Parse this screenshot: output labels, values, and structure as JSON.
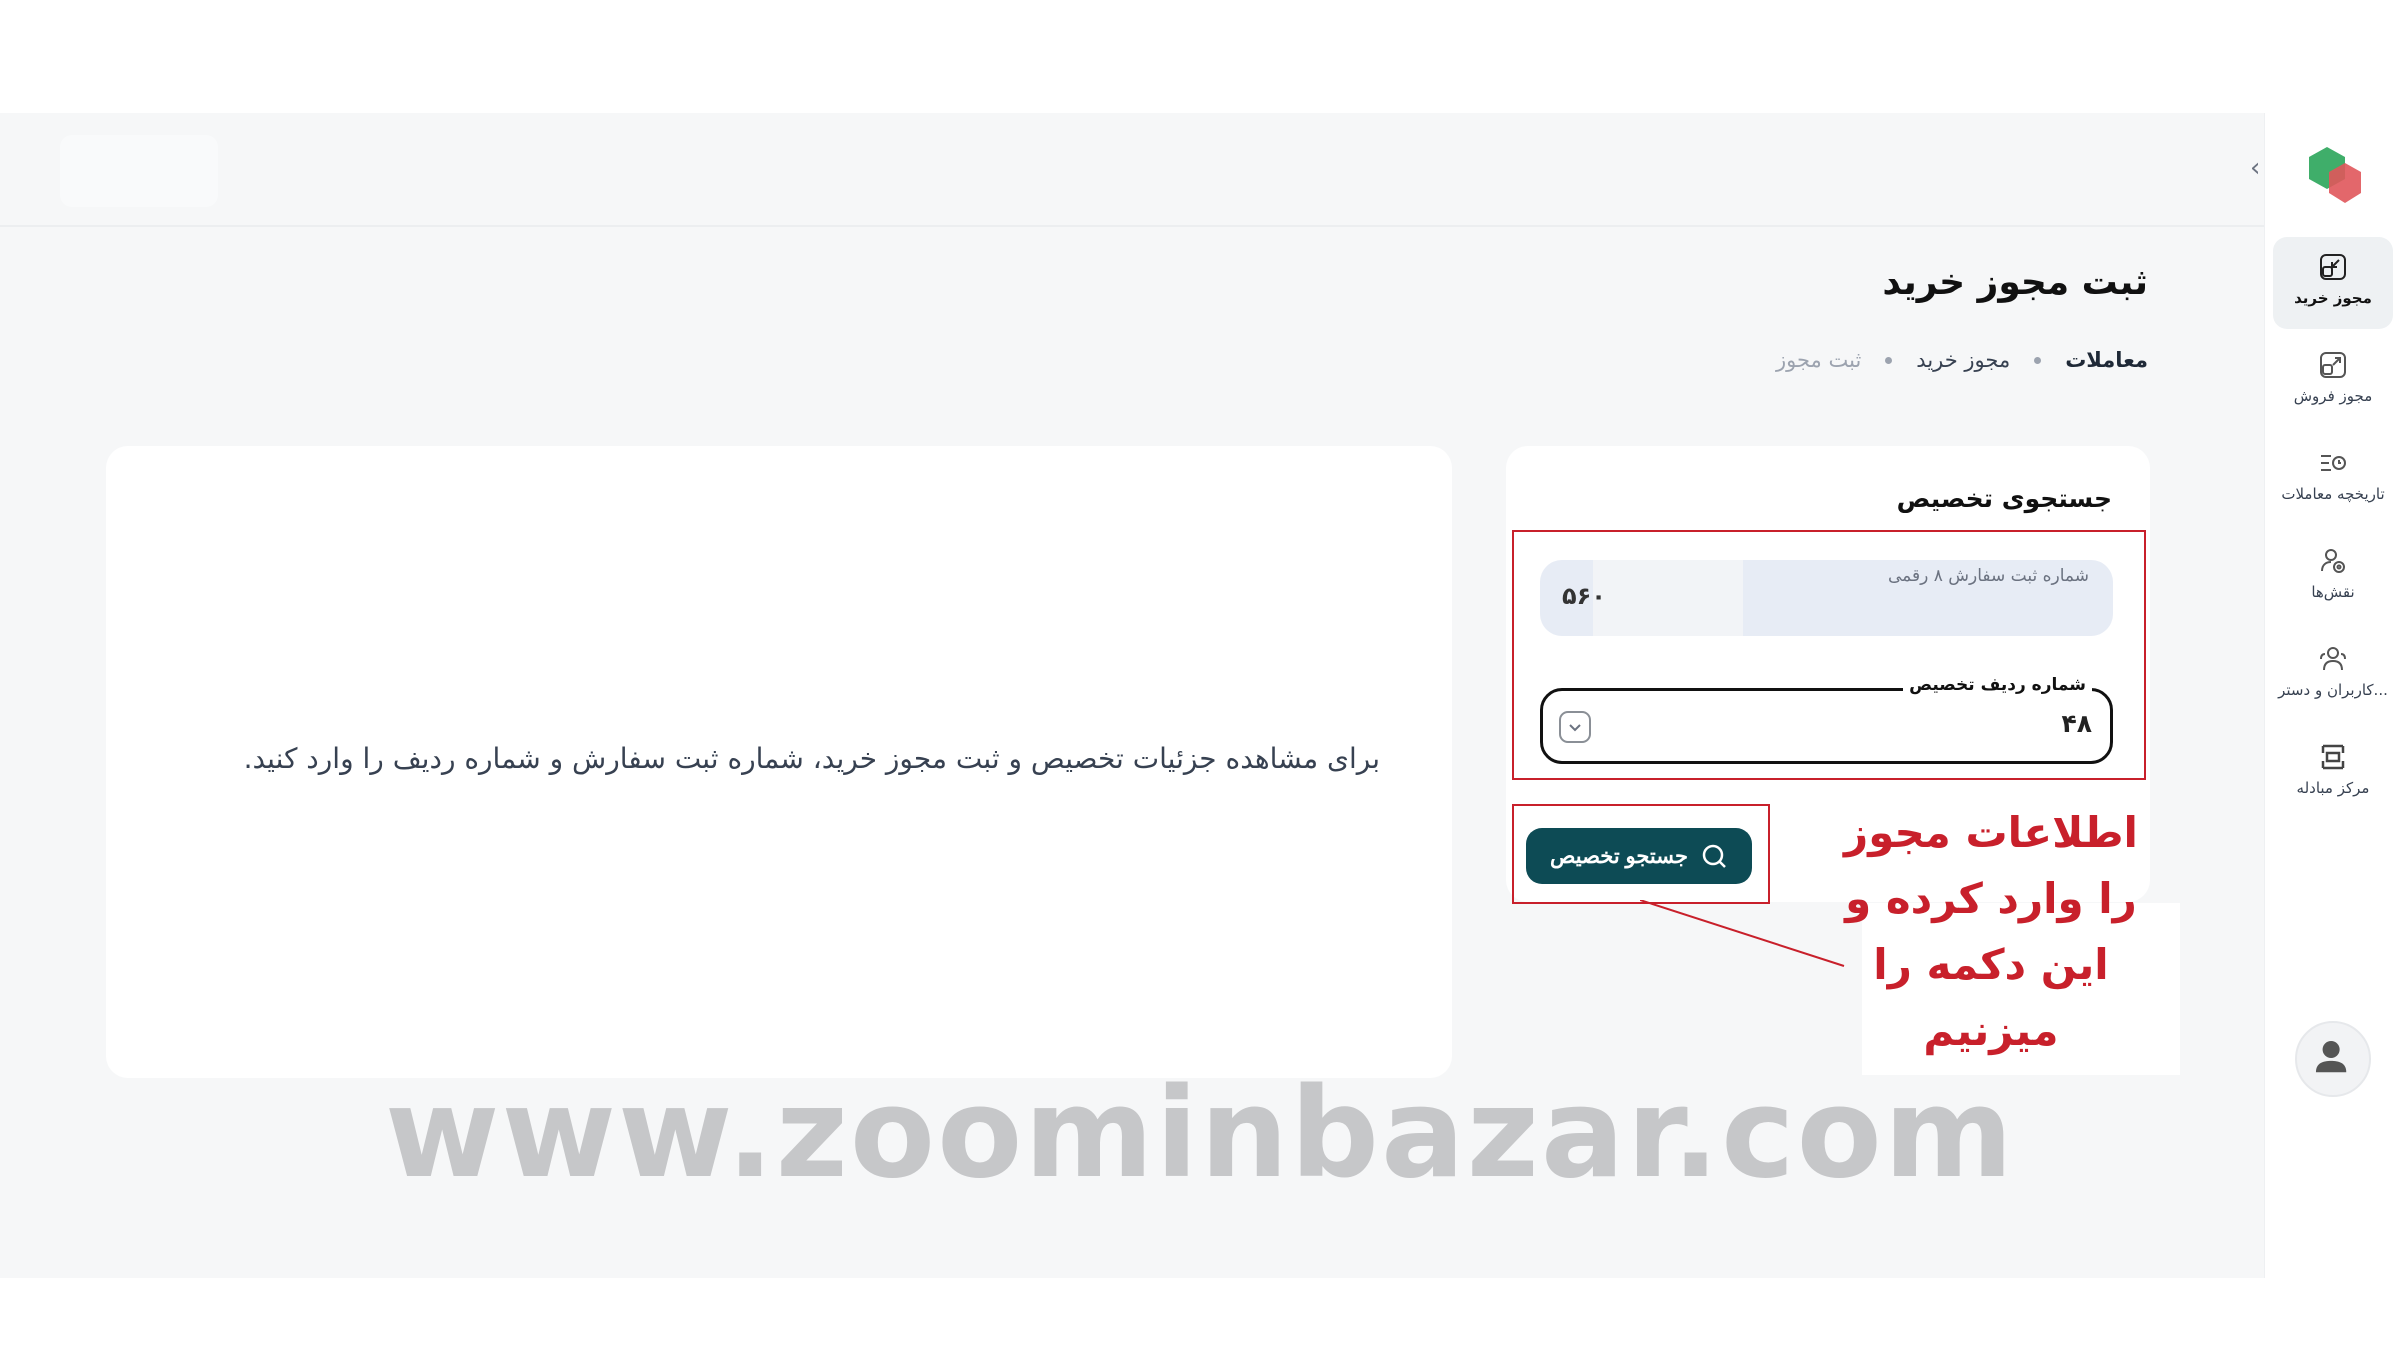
{
  "header": {
    "page_title": "ثبت مجوز خرید",
    "breadcrumb": [
      "معاملات",
      "مجوز خرید",
      "ثبت مجوز"
    ]
  },
  "sidebar": {
    "items": [
      {
        "label": "مجوز خرید",
        "icon": "purchase-permit-icon",
        "active": true
      },
      {
        "label": "مجوز فروش",
        "icon": "sale-permit-icon",
        "active": false
      },
      {
        "label": "تاریخچه معاملات",
        "icon": "history-icon",
        "active": false
      },
      {
        "label": "نقش‌ها",
        "icon": "roles-icon",
        "active": false
      },
      {
        "label": "کاربران و دستر...",
        "icon": "users-icon",
        "active": false
      },
      {
        "label": "مرکز مبادله",
        "icon": "exchange-center-icon",
        "active": false
      }
    ]
  },
  "search_card": {
    "title": "جستجوی تخصیص",
    "order_field": {
      "label": "شماره ثبت سفارش ۸ رقمی",
      "value": "۵۶۰"
    },
    "row_field": {
      "label": "شماره ردیف تخصیص",
      "value": "۴۸"
    },
    "button_label": "جستجو تخصیص"
  },
  "info_panel": {
    "message": "برای مشاهده جزئیات تخصیص و ثبت مجوز خرید، شماره ثبت سفارش و شماره ردیف را وارد کنید."
  },
  "annotation": {
    "lines": [
      "اطلاعات مجوز",
      "را وارد کرده و",
      "این دکمه را",
      "میزنیم"
    ],
    "color": "#c8202b"
  },
  "watermark": "www.zoominbazar.com",
  "colors": {
    "primary_button": "#0d4b55",
    "highlight": "#c8202b",
    "logo_green": "#3fae6a",
    "logo_red": "#e0575b"
  }
}
